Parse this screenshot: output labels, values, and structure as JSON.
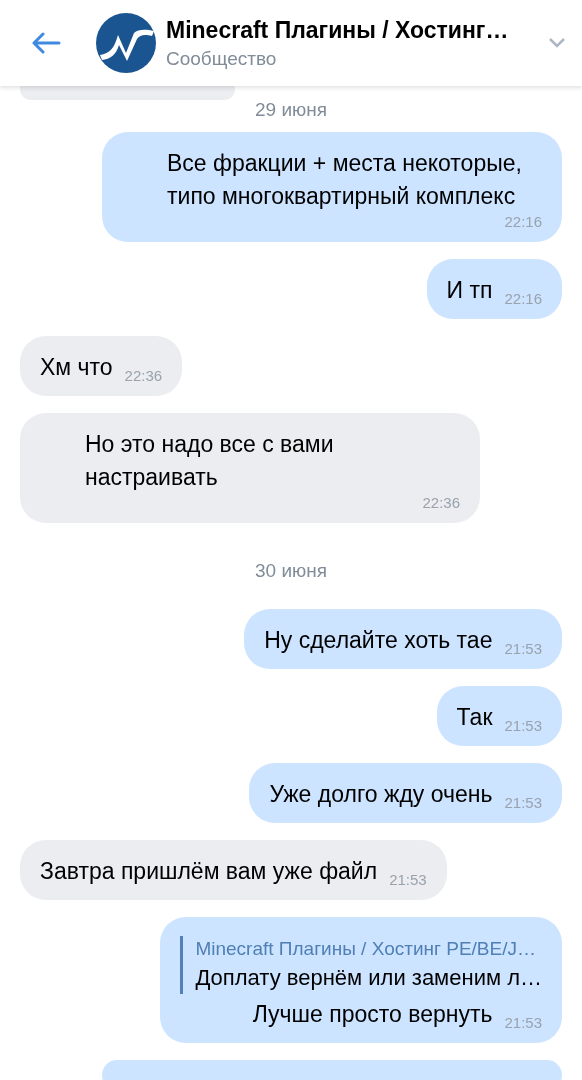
{
  "header": {
    "title": "Minecraft Плагины / Хостинг…",
    "subtitle": "Сообщество"
  },
  "messages": [
    {
      "kind": "stub",
      "outgoing": false
    },
    {
      "kind": "date",
      "text": "29 июня"
    },
    {
      "kind": "message",
      "outgoing": true,
      "text": "Все фракции + места некоторые, типо многоквартирный комплекс",
      "time": "22:16"
    },
    {
      "kind": "message",
      "outgoing": true,
      "text": "И тп",
      "time": "22:16"
    },
    {
      "kind": "message",
      "outgoing": false,
      "text": "Хм что",
      "time": "22:36"
    },
    {
      "kind": "message",
      "outgoing": false,
      "text": "Но это надо все с вами настраивать",
      "time": "22:36"
    },
    {
      "kind": "date",
      "text": "30 июня"
    },
    {
      "kind": "message",
      "outgoing": true,
      "text": "Ну сделайте хоть тае",
      "time": "21:53"
    },
    {
      "kind": "message",
      "outgoing": true,
      "text": "Так",
      "time": "21:53"
    },
    {
      "kind": "message",
      "outgoing": true,
      "text": "Уже долго жду очень",
      "time": "21:53"
    },
    {
      "kind": "message",
      "outgoing": false,
      "text": "Завтра пришлём вам уже файл",
      "time": "21:53"
    },
    {
      "kind": "message",
      "outgoing": true,
      "text": "Лучше просто вернуть",
      "time": "21:53",
      "reply": {
        "author": "Minecraft Плагины / Хостинг PE/BE/J…",
        "text": "Доплату вернём или заменим л…"
      }
    },
    {
      "kind": "stub",
      "outgoing": true
    }
  ]
}
